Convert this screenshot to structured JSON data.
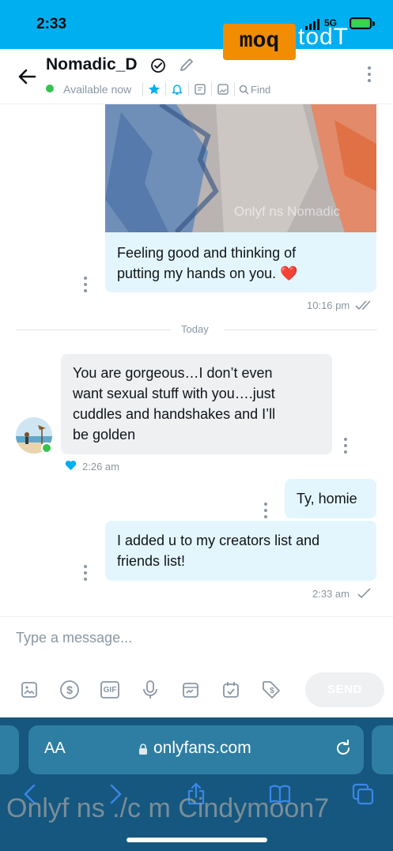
{
  "status_bar": {
    "time": "2:33",
    "network": "5G"
  },
  "watermark": {
    "badge": "moq",
    "suffix": "todT",
    "image_text": "Onlyf ns Nomadic",
    "bottom_text": "Onlyf ns ./c m Cindymoon7"
  },
  "header": {
    "name": "Nomadic_D",
    "status": "Available now",
    "find_label": "Find"
  },
  "messages": [
    {
      "direction": "out",
      "type": "image",
      "text_line1": "Feeling good and thinking of",
      "text_line2": "putting my hands on you.",
      "emoji": "❤️",
      "time": "10:16 pm",
      "read": true
    },
    {
      "type": "divider",
      "label": "Today"
    },
    {
      "direction": "in",
      "text_lines": [
        "You are gorgeous…I don’t even",
        "want sexual stuff with you….just",
        "cuddles and handshakes and I’ll",
        "be golden"
      ],
      "time": "2:26 am",
      "liked": true
    },
    {
      "direction": "out",
      "text": "Ty, homie"
    },
    {
      "direction": "out",
      "text_line1": "I added u to my creators list and",
      "text_line2": "friends list!",
      "time": "2:33 am",
      "read": false
    }
  ],
  "composer": {
    "placeholder": "Type a message...",
    "send_label": "SEND",
    "tools": [
      "image-icon",
      "dollar-icon",
      "gif-icon",
      "mic-icon",
      "vault-icon",
      "calendar-icon",
      "price-tag-icon"
    ],
    "gif_label": "GIF"
  },
  "browser": {
    "aa_label": "AA",
    "url": "onlyfans.com"
  },
  "colors": {
    "brand": "#00aff0",
    "out_bubble": "#e4f6fd",
    "in_bubble": "#eef0f2",
    "online": "#33c44e",
    "heart": "#e0202f",
    "safari": "#15577f"
  }
}
